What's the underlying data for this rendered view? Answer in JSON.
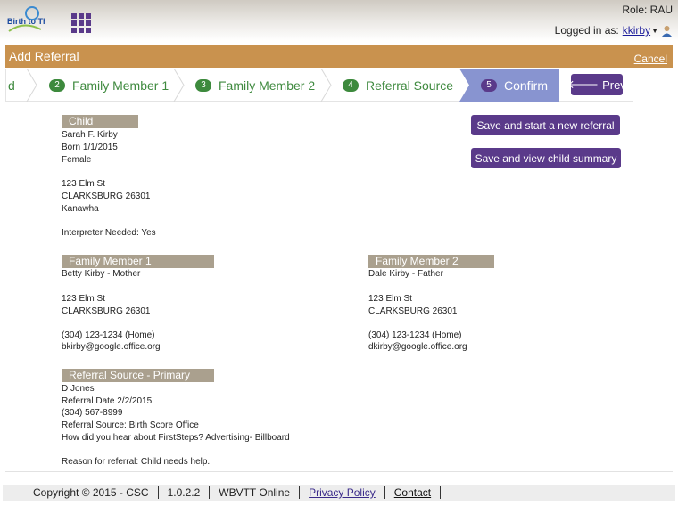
{
  "header": {
    "logo_alt": "Birth to Three",
    "role": "Role: RAU",
    "logged_in_label": "Logged in as:",
    "username": "kkirby"
  },
  "titlebar": {
    "title": "Add Referral",
    "cancel": "Cancel"
  },
  "wizard": {
    "steps": [
      {
        "num": "",
        "label": "d"
      },
      {
        "num": "2",
        "label": "Family Member 1"
      },
      {
        "num": "3",
        "label": "Family Member 2"
      },
      {
        "num": "4",
        "label": "Referral Source"
      },
      {
        "num": "5",
        "label": "Confirm"
      }
    ],
    "prev": "Prev"
  },
  "actions": {
    "save_new": "Save and start a new referral",
    "save_view": "Save and view child summary"
  },
  "child": {
    "header": "Child",
    "name": "Sarah F. Kirby",
    "born": "Born 1/1/2015",
    "sex": "Female",
    "street": "123 Elm St",
    "city": "CLARKSBURG 26301",
    "county": "Kanawha",
    "interpreter": "Interpreter Needed: Yes"
  },
  "fm1": {
    "header": "Family Member 1",
    "name": "Betty Kirby - Mother",
    "street": "123 Elm St",
    "city": "CLARKSBURG 26301",
    "phone": "(304) 123-1234 (Home)",
    "email": "bkirby@google.office.org"
  },
  "fm2": {
    "header": "Family Member 2",
    "name": "Dale Kirby - Father",
    "street": "123 Elm St",
    "city": "CLARKSBURG 26301",
    "phone": "(304) 123-1234 (Home)",
    "email": "dkirby@google.office.org"
  },
  "referral": {
    "header": "Referral Source - Primary",
    "name": "D Jones",
    "date": "Referral Date 2/2/2015",
    "phone": "(304) 567-8999",
    "source": "Referral Source: Birth Score Office",
    "heard": "How did you hear about FirstSteps? Advertising- Billboard",
    "reason": "Reason for referral: Child needs help."
  },
  "footer": {
    "copyright": "Copyright © 2015 - CSC",
    "version": "1.0.2.2",
    "app": "WBVTT Online",
    "privacy": "Privacy Policy",
    "contact": "Contact"
  },
  "colors": {
    "accent": "#5a3a8a",
    "titlebar": "#c9924e",
    "step_green": "#3d8a3d",
    "step_active": "#8894d0",
    "section_header": "#aaa08e"
  }
}
